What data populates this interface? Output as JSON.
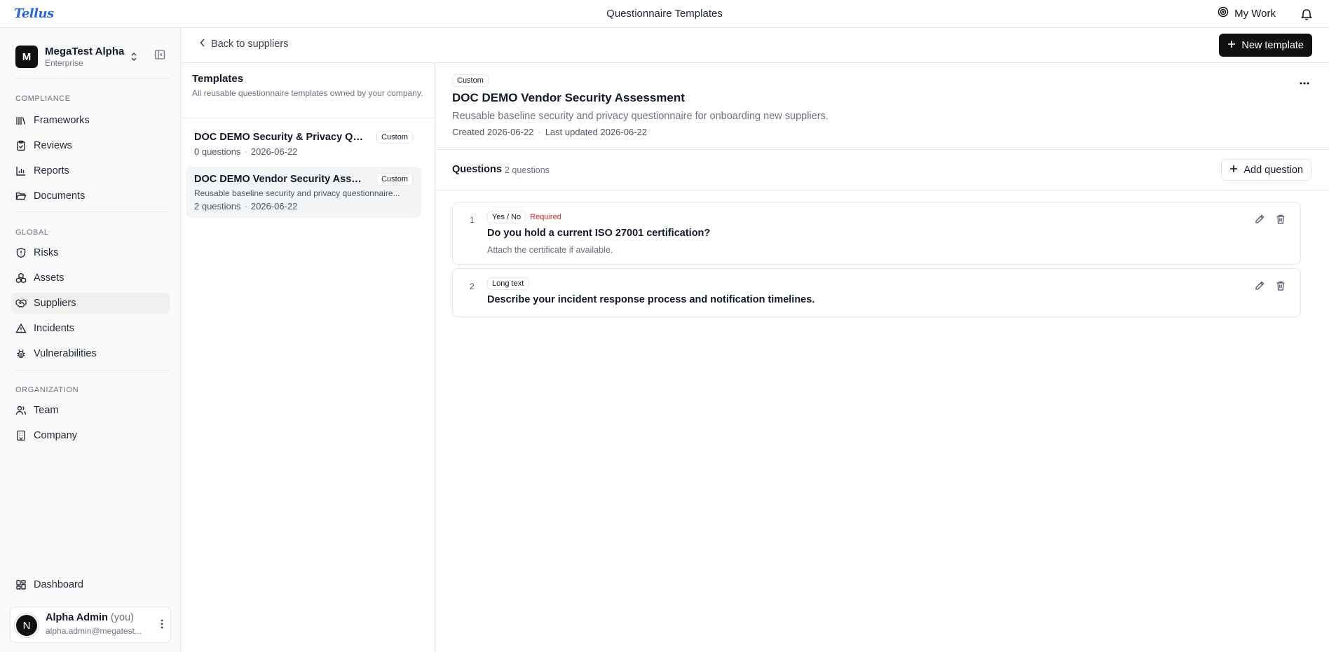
{
  "app": {
    "logo": "Tellus",
    "page_title": "Questionnaire Templates",
    "my_work": "My Work"
  },
  "org": {
    "initial": "M",
    "name": "MegaTest Alpha",
    "plan": "Enterprise"
  },
  "sidebar": {
    "sections": [
      {
        "label": "COMPLIANCE",
        "items": [
          {
            "label": "Frameworks",
            "icon": "library-icon"
          },
          {
            "label": "Reviews",
            "icon": "clipboard-check-icon"
          },
          {
            "label": "Reports",
            "icon": "bar-chart-icon"
          },
          {
            "label": "Documents",
            "icon": "folder-open-icon"
          }
        ]
      },
      {
        "label": "GLOBAL",
        "items": [
          {
            "label": "Risks",
            "icon": "shield-icon"
          },
          {
            "label": "Assets",
            "icon": "boxes-icon"
          },
          {
            "label": "Suppliers",
            "icon": "handshake-icon",
            "active": true
          },
          {
            "label": "Incidents",
            "icon": "alert-triangle-icon"
          },
          {
            "label": "Vulnerabilities",
            "icon": "bug-icon"
          }
        ]
      },
      {
        "label": "ORGANIZATION",
        "items": [
          {
            "label": "Team",
            "icon": "users-icon"
          },
          {
            "label": "Company",
            "icon": "building-icon"
          }
        ]
      }
    ],
    "dashboard": "Dashboard",
    "user": {
      "initial": "N",
      "name": "Alpha Admin",
      "you": "(you)",
      "email": "alpha.admin@megatest..."
    }
  },
  "subheader": {
    "back": "Back to suppliers",
    "new_template": "New template"
  },
  "templates": {
    "title": "Templates",
    "description": "All reusable questionnaire templates owned by your company.",
    "items": [
      {
        "name": "DOC DEMO Security & Privacy Ques...",
        "badge": "Custom",
        "questions": "0 questions",
        "date": "2026-06-22",
        "selected": false
      },
      {
        "name": "DOC DEMO Vendor Security Assess...",
        "badge": "Custom",
        "subtitle": "Reusable baseline security and privacy questionnaire...",
        "questions": "2 questions",
        "date": "2026-06-22",
        "selected": true
      }
    ]
  },
  "detail": {
    "badge": "Custom",
    "title": "DOC DEMO Vendor Security Assessment",
    "description": "Reusable baseline security and privacy questionnaire for onboarding new suppliers.",
    "created": "Created 2026-06-22",
    "updated": "Last updated 2026-06-22",
    "questions_label": "Questions",
    "questions_count": "2 questions",
    "add_question": "Add question",
    "questions": [
      {
        "number": "1",
        "type": "Yes / No",
        "required": "Required",
        "text": "Do you hold a current ISO 27001 certification?",
        "help": "Attach the certificate if available."
      },
      {
        "number": "2",
        "type": "Long text",
        "text": "Describe your incident response process and notification timelines."
      }
    ]
  },
  "colors": {
    "accent_logo": "#2563eb",
    "primary_button": "#111111",
    "required": "#dc2626"
  }
}
